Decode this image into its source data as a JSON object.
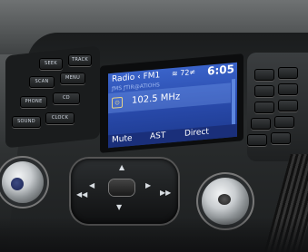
{
  "screen": {
    "source": "Radio ‹ FM1",
    "tuner": "≋ 72≠",
    "time": "6:05",
    "subtitle": "ƒMS ƒTIR@ATIOHS",
    "frequency": "102.5 MHz",
    "bottom": [
      "Mute",
      "AST",
      "Direct"
    ]
  },
  "left_panel": {
    "buttons": [
      "SEEK",
      "TRACK",
      "SCAN",
      "MENU",
      "PHONE",
      "CD",
      "SOUND",
      "CLOCK"
    ]
  },
  "colors": {
    "screen_blue": "#2849a9",
    "label_blue": "#cfd6e0",
    "knob_chrome": "#c9cdd0"
  }
}
